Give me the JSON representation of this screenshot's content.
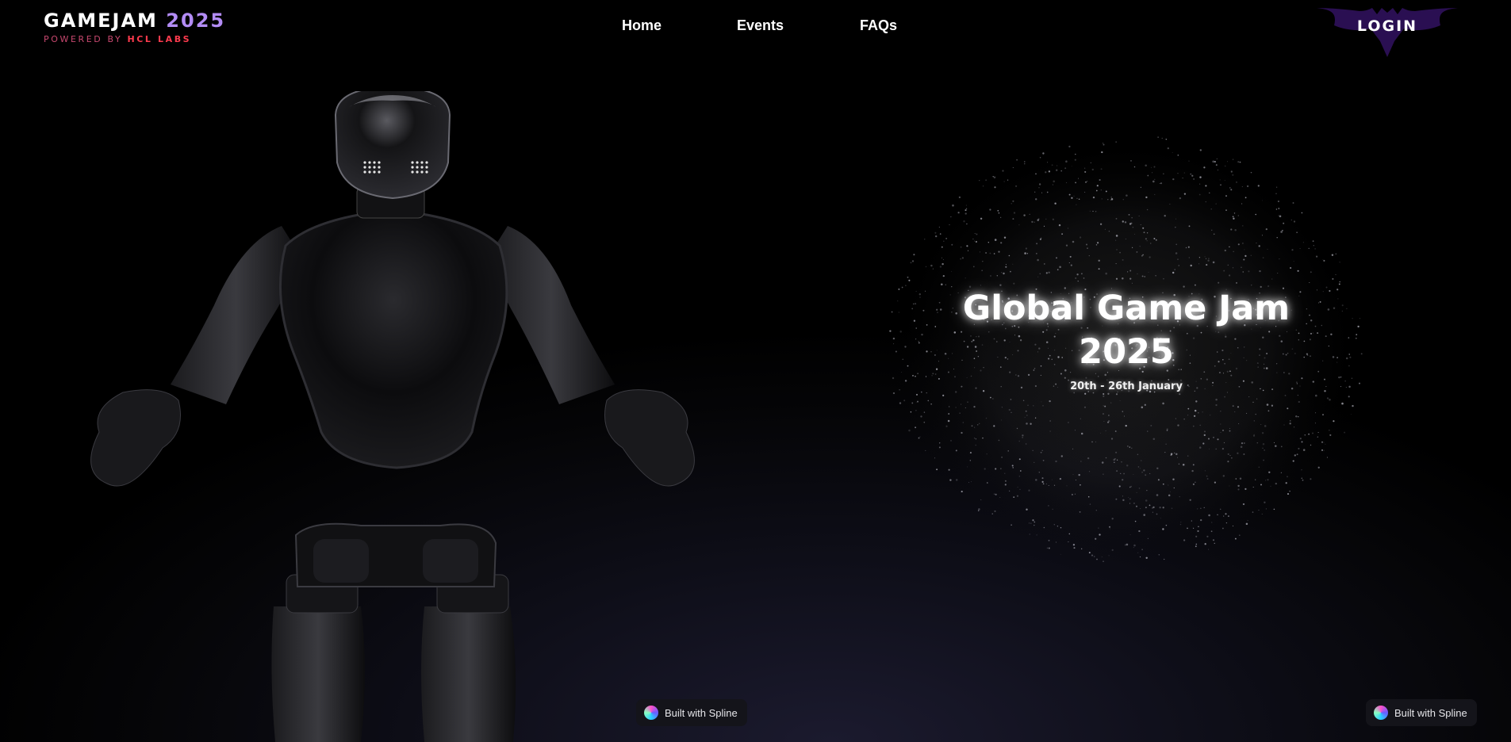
{
  "brand": {
    "title": "GAMEJAM",
    "year": "2025",
    "powered_by": "POWERED BY",
    "company": "HCL LABS"
  },
  "nav": {
    "items": [
      {
        "label": "Home"
      },
      {
        "label": "Events"
      },
      {
        "label": "FAQs"
      }
    ]
  },
  "login": {
    "label": "LOGIN",
    "icon": "bat-emblem-icon",
    "color": "#2a0f52"
  },
  "hero": {
    "title_line1": "Global Game Jam",
    "title_line2": "2025",
    "date": "20th - 26th January"
  },
  "badges": [
    {
      "label": "Built with Spline",
      "icon": "spline-logo-icon"
    },
    {
      "label": "Built with Spline",
      "icon": "spline-logo-icon"
    }
  ],
  "colors": {
    "accent_purple": "#b38cf5",
    "accent_red": "#ff3b4e",
    "background": "#000000"
  }
}
